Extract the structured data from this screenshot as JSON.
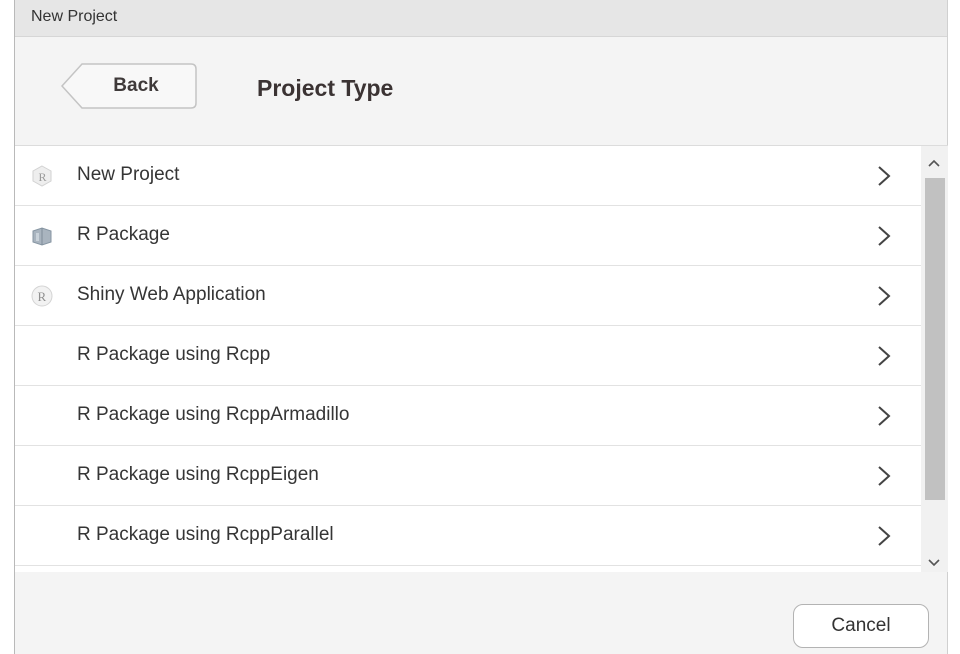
{
  "window": {
    "title": "New Project"
  },
  "header": {
    "back_label": "Back",
    "title": "Project Type"
  },
  "project_types": [
    {
      "label": "New Project",
      "icon": "r-project-icon"
    },
    {
      "label": "R Package",
      "icon": "package-icon"
    },
    {
      "label": "Shiny Web Application",
      "icon": "shiny-icon"
    },
    {
      "label": "R Package using Rcpp",
      "icon": ""
    },
    {
      "label": "R Package using RcppArmadillo",
      "icon": ""
    },
    {
      "label": "R Package using RcppEigen",
      "icon": ""
    },
    {
      "label": "R Package using RcppParallel",
      "icon": ""
    }
  ],
  "footer": {
    "cancel_label": "Cancel"
  },
  "colors": {
    "window_bg": "#f4f4f4",
    "titlebar_bg": "#e6e6e6",
    "list_bg": "#ffffff",
    "scroll_thumb": "#c1c1c1"
  }
}
